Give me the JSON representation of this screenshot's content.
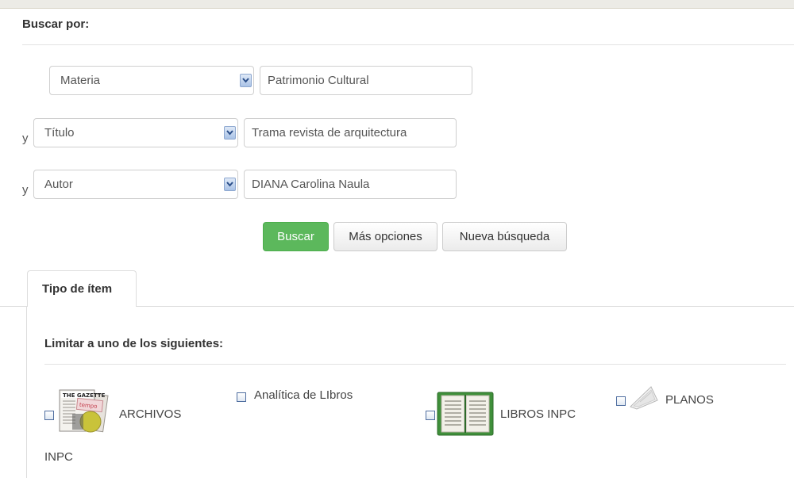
{
  "search": {
    "heading": "Buscar por:",
    "rows": [
      {
        "conjunction": "",
        "field": "Materia",
        "value": "Patrimonio Cultural"
      },
      {
        "conjunction": "y",
        "field": "Título",
        "value": "Trama revista de arquitectura"
      },
      {
        "conjunction": "y",
        "field": "Autor",
        "value": "DIANA Carolina Naula"
      }
    ],
    "buttons": {
      "search": "Buscar",
      "more_options": "Más opciones",
      "new_search": "Nueva búsqueda"
    }
  },
  "filters": {
    "tab_label": "Tipo de ítem",
    "limit_label": "Limitar a uno de los siguientes:",
    "item_types": [
      {
        "label": "ARCHIVOS",
        "label_line2": "INPC",
        "icon": "gazette-newspaper-icon",
        "checked": false
      },
      {
        "label": "Analítica de LIbros",
        "icon": "",
        "checked": false
      },
      {
        "label": "LIBROS INPC",
        "icon": "open-book-icon",
        "checked": false
      },
      {
        "label": "PLANOS",
        "icon": "blueprint-paper-icon",
        "checked": false
      }
    ]
  },
  "colors": {
    "primary_button": "#5cb85c",
    "checkbox_border": "#4f6ea0",
    "select_arrow": "#a9c2e6"
  }
}
